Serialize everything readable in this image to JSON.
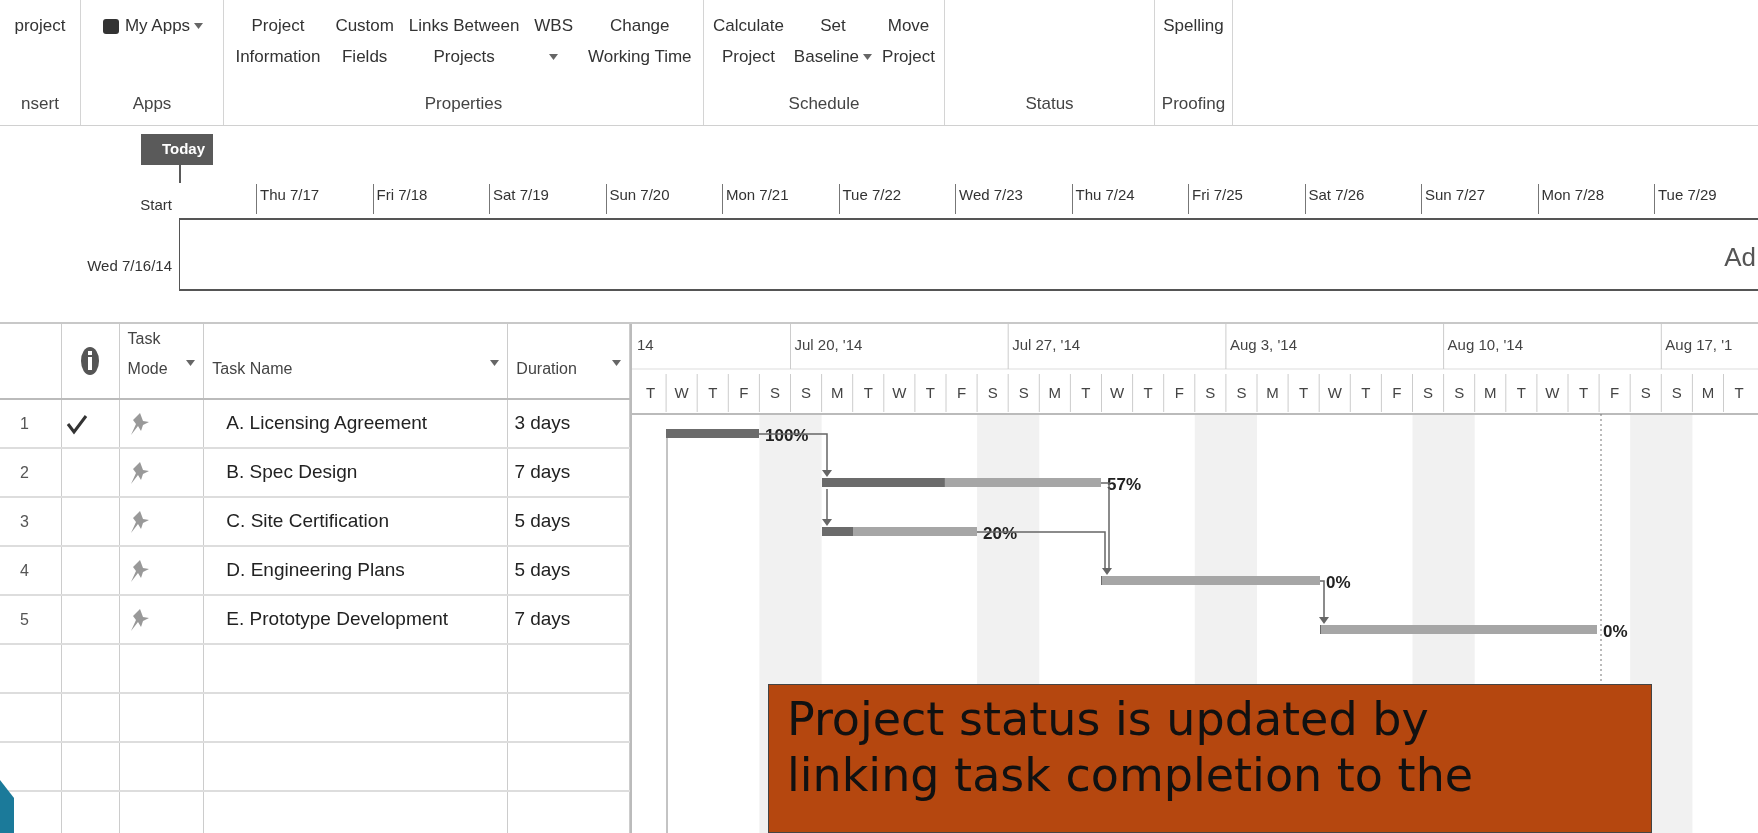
{
  "ribbon": {
    "groups": [
      {
        "label": "nsert",
        "items": [
          {
            "lines": [
              "project"
            ]
          }
        ]
      },
      {
        "label": "Apps",
        "items": [
          {
            "lines": [
              "My Apps"
            ],
            "dropdown": true,
            "kind": "apps"
          }
        ]
      },
      {
        "label": "Properties",
        "items": [
          {
            "lines": [
              "Project",
              "Information"
            ]
          },
          {
            "lines": [
              "Custom",
              "Fields"
            ]
          },
          {
            "lines": [
              "Links Between",
              "Projects"
            ]
          },
          {
            "lines": [
              "WBS"
            ],
            "dropdown": true
          },
          {
            "lines": [
              "Change",
              "Working Time"
            ]
          }
        ]
      },
      {
        "label": "Schedule",
        "items": [
          {
            "lines": [
              "Calculate",
              "Project"
            ]
          },
          {
            "lines": [
              "Set",
              "Baseline"
            ],
            "dropdown": true
          },
          {
            "lines": [
              "Move",
              "Project"
            ]
          }
        ]
      },
      {
        "label": "Status"
      },
      {
        "label": "Proofing",
        "items": [
          {
            "lines": [
              "Spelling"
            ]
          }
        ]
      }
    ]
  },
  "timeline": {
    "today": "Today",
    "start_label": "Start",
    "start_date": "Wed 7/16/14",
    "edge_text": "Ad",
    "dates": [
      "Thu 7/17",
      "Fri 7/18",
      "Sat 7/19",
      "Sun 7/20",
      "Mon 7/21",
      "Tue 7/22",
      "Wed 7/23",
      "Thu 7/24",
      "Fri 7/25",
      "Sat 7/26",
      "Sun 7/27",
      "Mon 7/28",
      "Tue 7/29"
    ]
  },
  "table": {
    "columns": [
      {
        "kind": "indicator"
      },
      {
        "kind": "text",
        "lines": [
          "Task",
          "Mode"
        ],
        "dropdown": true
      },
      {
        "kind": "text",
        "lines": [
          "Task Name"
        ],
        "dropdown": true
      },
      {
        "kind": "text",
        "lines": [
          "Duration"
        ],
        "dropdown": true
      }
    ],
    "rows": [
      {
        "id": "1",
        "complete": true,
        "name": "A. Licensing Agreement",
        "duration": "3 days"
      },
      {
        "id": "2",
        "complete": false,
        "name": "B. Spec Design",
        "duration": "7 days"
      },
      {
        "id": "3",
        "complete": false,
        "name": "C. Site Certification",
        "duration": "5 days"
      },
      {
        "id": "4",
        "complete": false,
        "name": "D. Engineering Plans",
        "duration": "5 days"
      },
      {
        "id": "5",
        "complete": false,
        "name": "E. Prototype Development",
        "duration": "7 days"
      }
    ]
  },
  "gantt": {
    "weeks": [
      "14",
      "Jul 20, '14",
      "Jul 27, '14",
      "Aug 3, '14",
      "Aug 10, '14",
      "Aug 17, '1"
    ],
    "days": [
      "T",
      "W",
      "T",
      "F",
      "S",
      "S",
      "M",
      "T",
      "W",
      "T",
      "F",
      "S",
      "S",
      "M",
      "T",
      "W",
      "T",
      "F",
      "S",
      "S",
      "M",
      "T",
      "W",
      "T",
      "F",
      "S",
      "S",
      "M",
      "T",
      "W",
      "T",
      "F",
      "S",
      "S",
      "M",
      "T"
    ],
    "bars": [
      {
        "level": 1,
        "label": "100%"
      },
      {
        "level": 0.44,
        "label": "57%"
      },
      {
        "level": 0.2,
        "label": "20%"
      },
      {
        "level": 0,
        "label": "0%"
      },
      {
        "level": 0,
        "label": "0%"
      }
    ]
  },
  "callout": {
    "text": "Project status is updated by linking task completion to the"
  }
}
